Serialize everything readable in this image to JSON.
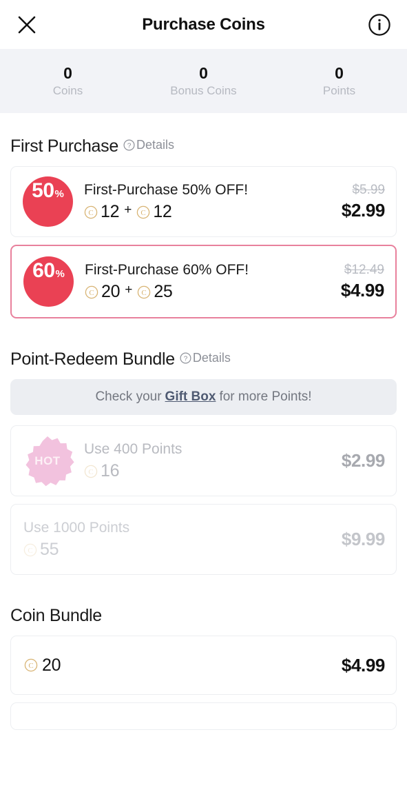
{
  "header": {
    "title": "Purchase Coins",
    "close_icon": "close-icon",
    "info_icon": "info-icon"
  },
  "stats": [
    {
      "value": "0",
      "label": "Coins"
    },
    {
      "value": "0",
      "label": "Bonus Coins"
    },
    {
      "value": "0",
      "label": "Points"
    }
  ],
  "sections": {
    "first_purchase": {
      "title": "First Purchase",
      "details_label": "Details",
      "offers": [
        {
          "badge_num": "50",
          "badge_pct": "%",
          "title": "First-Purchase 50% OFF!",
          "coins": "12",
          "plus": "+",
          "bonus_coins": "12",
          "price_old": "$5.99",
          "price_new": "$2.99",
          "selected": false
        },
        {
          "badge_num": "60",
          "badge_pct": "%",
          "title": "First-Purchase 60% OFF!",
          "coins": "20",
          "plus": "+",
          "bonus_coins": "25",
          "price_old": "$12.49",
          "price_new": "$4.99",
          "selected": true
        }
      ]
    },
    "point_redeem": {
      "title": "Point-Redeem Bundle",
      "details_label": "Details",
      "banner": {
        "prefix": "Check your",
        "link": "Gift Box",
        "suffix": "for more Points!"
      },
      "offers": [
        {
          "badge_text": "HOT",
          "title": "Use 400 Points",
          "coins": "16",
          "price": "$2.99"
        },
        {
          "badge_text": "",
          "title": "Use 1000 Points",
          "coins": "55",
          "price": "$9.99"
        }
      ]
    },
    "coin_bundle": {
      "title": "Coin Bundle",
      "offers": [
        {
          "coins": "20",
          "price": "$4.99"
        }
      ]
    }
  },
  "colors": {
    "discount_badge": "#ea4154",
    "selected_border": "#e8809c",
    "hot_badge": "#f2c2de",
    "coin_gold": "#d8b474",
    "stats_bg": "#f2f3f7",
    "banner_bg": "#eceef2",
    "link": "#4f5a72"
  }
}
